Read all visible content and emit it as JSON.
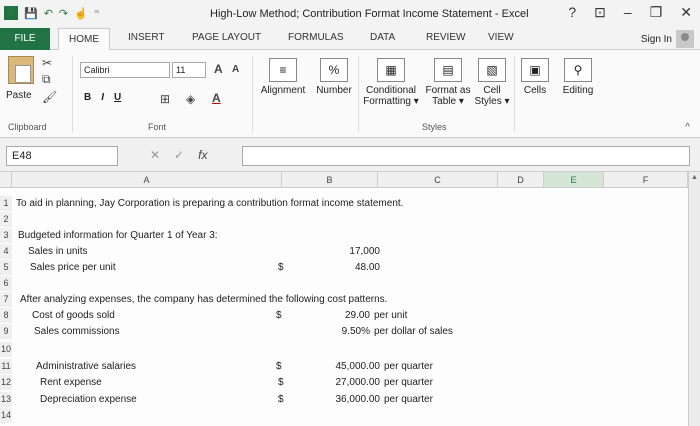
{
  "window": {
    "title": "High-Low Method; Contribution Format Income Statement - Excel",
    "help": "?",
    "controls": [
      "–",
      "✕"
    ]
  },
  "tabs": [
    "FILE",
    "HOME",
    "INSERT",
    "PAGE LAYOUT",
    "FORMULAS",
    "DATA",
    "REVIEW",
    "VIEW"
  ],
  "account": {
    "signin": "Sign In"
  },
  "ribbon": {
    "paste": "Paste",
    "clipboard": "Clipboard",
    "font_name": "Calibri",
    "font_size": "11",
    "grow_font": "A",
    "shrink_font": "A",
    "bold": "B",
    "italic": "I",
    "underline": "U",
    "font_color": "A",
    "font_group": "Font",
    "alignment": "Alignment",
    "number": "Number",
    "conditional_formatting": [
      "Conditional",
      "Formatting ▾"
    ],
    "format_as_table": [
      "Format as",
      "Table ▾"
    ],
    "cell_styles": [
      "Cell",
      "Styles ▾"
    ],
    "styles_group": "Styles",
    "cells": "Cells",
    "editing": "Editing",
    "percent": "%",
    "fx": "fx",
    "fx_cancel": "✕",
    "fx_enter": "✓"
  },
  "formula_bar": {
    "name_box": "E48",
    "formula": ""
  },
  "columns": [
    "A",
    "B",
    "C",
    "D",
    "E",
    "F"
  ],
  "rows": [
    "1",
    "2",
    "3",
    "4",
    "5",
    "6",
    "7",
    "8",
    "9",
    "10",
    "11",
    "12",
    "13",
    "14"
  ],
  "cells": {
    "r1": "To aid in planning, Jay Corporation is preparing a contribution format income statement.",
    "r3": "Budgeted information for Quarter 1 of Year 3:",
    "r4": "Sales in units",
    "r4_val": "17,000",
    "r5": "Sales price per unit",
    "r5_cur": "$",
    "r5_val": "48.00",
    "r7": "After analyzing expenses, the company has determined the following cost patterns.",
    "r8": "Cost of goods sold",
    "r8_cur": "$",
    "r8_val": "29.00",
    "r8_unit": "per unit",
    "r9": "Sales commissions",
    "r9_val": "9.50%",
    "r9_unit": "per dollar of sales",
    "r11": "Administrative salaries",
    "r11_cur": "$",
    "r11_val": "45,000.00",
    "r11_unit": "per quarter",
    "r12": "Rent expense",
    "r12_cur": "$",
    "r12_val": "27,000.00",
    "r12_unit": "per quarter",
    "r13": "Depreciation expense",
    "r13_cur": "$",
    "r13_val": "36,000.00",
    "r13_unit": "per quarter"
  }
}
